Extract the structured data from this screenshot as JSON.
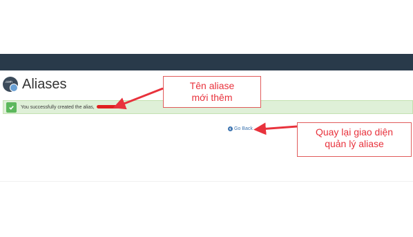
{
  "header": {
    "page_title": "Aliases"
  },
  "alert": {
    "message": "You successfully created the alias,",
    "status_color": "#5cb85c"
  },
  "nav": {
    "go_back_label": "Go Back"
  },
  "annotations": {
    "alias_name_note": [
      "Tên aliase",
      "mới thêm"
    ],
    "go_back_note": [
      "Quay lại giao diện",
      "quản lý aliase"
    ],
    "accent_color": "#e8323c"
  },
  "icons": {
    "logo": "domain-com-icon",
    "success": "check-icon",
    "back": "arrow-circle-icon"
  }
}
